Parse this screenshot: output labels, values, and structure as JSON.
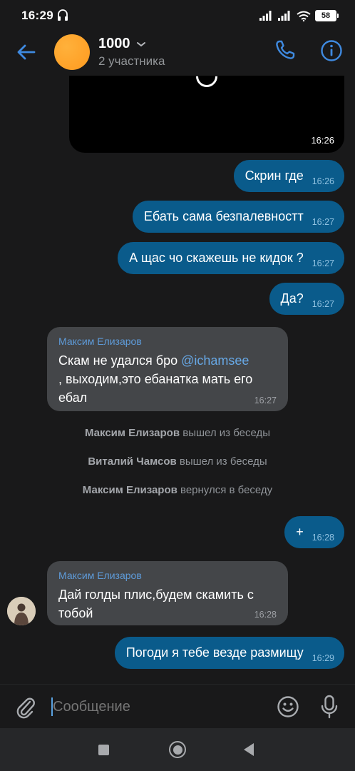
{
  "status_bar": {
    "time": "16:29",
    "battery": "58"
  },
  "header": {
    "title": "1000",
    "subtitle": "2 участника"
  },
  "messages": {
    "media_time": "16:26",
    "m1": {
      "text": "Скрин где",
      "time": "16:26"
    },
    "m2": {
      "text": "Ебать сама безпалевностт",
      "time": "16:27"
    },
    "m3": {
      "text": "А щас чо скажешь не кидок ?",
      "time": "16:27"
    },
    "m4": {
      "text": "Да?",
      "time": "16:27"
    },
    "m5": {
      "sender": "Максим Елизаров",
      "text_before": "Скам не удался бро ",
      "mention": "@ichamsee",
      "text_after": ", выходим,это ебанатка мать его ебал",
      "time": "16:27"
    },
    "service1": {
      "name": "Максим Елизаров",
      "action": "вышел из беседы"
    },
    "service2": {
      "name": "Виталий Чамсов",
      "action": "вышел из беседы"
    },
    "service3": {
      "name": "Максим Елизаров",
      "action": "вернулся в беседу"
    },
    "m6": {
      "text": "+",
      "time": "16:28"
    },
    "m7": {
      "sender": "Максим Елизаров",
      "text": "Дай голды плис,будем скамить с тобой",
      "time": "16:28"
    },
    "m8": {
      "text": "Погоди я тебе везде размищу",
      "time": "16:29"
    }
  },
  "composer": {
    "placeholder": "Сообщение"
  },
  "colors": {
    "background": "#19191a",
    "outgoing_bubble": "#0a5b8b",
    "incoming_bubble": "#444649",
    "accent": "#3f8ae0",
    "avatar": "#ff9a1f"
  },
  "icons": {
    "back": "arrow-left-icon",
    "call": "phone-icon",
    "info": "info-icon",
    "attach": "paperclip-icon",
    "emoji": "smile-icon",
    "mic": "microphone-icon"
  }
}
